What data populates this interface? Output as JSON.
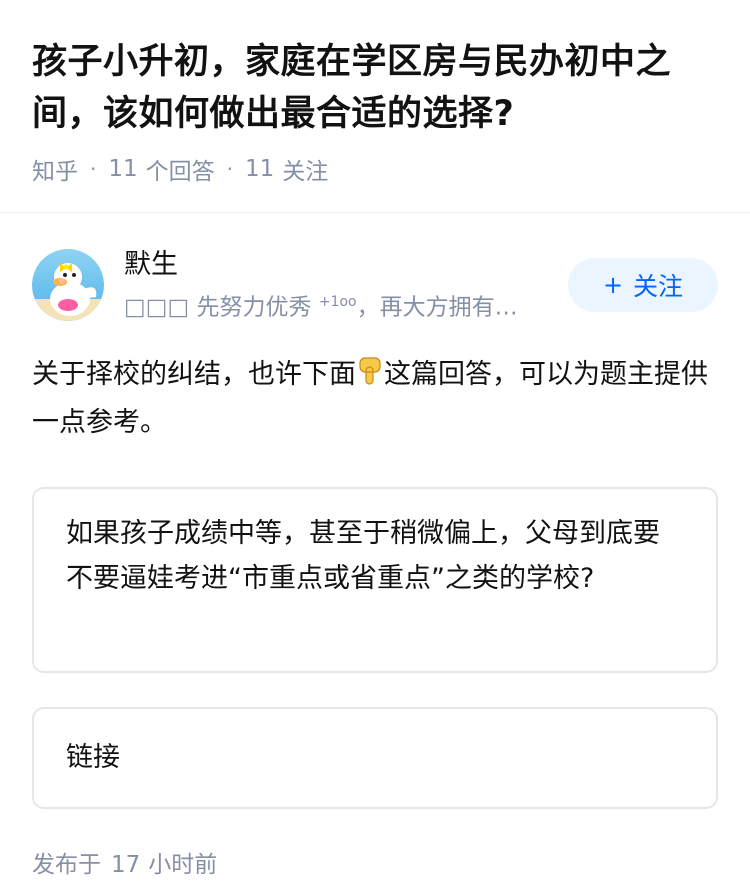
{
  "question": {
    "title": "孩子小升初，家庭在学区房与民办初中之间，该如何做出最合适的选择?",
    "source": "知乎",
    "answer_count": "11",
    "answer_label": "个回答",
    "follower_count": "11",
    "follower_label": "关注"
  },
  "author": {
    "name": "默生",
    "bio_prefix": "□□□ 先努力优秀",
    "bio_sup": "+1oo",
    "bio_suffix": "，再大方拥有…",
    "follow_label": "关注",
    "follow_icon": "plus-icon"
  },
  "answer": {
    "text_before": "关于择校的纠结，也许下面",
    "emoji": "pointing-down-hand-emoji",
    "text_after": "这篇回答，可以为题主提供一点参考。",
    "quote": "如果孩子成绩中等，甚至于稍微偏上，父母到底要不要逼娃考进“市重点或省重点”之类的学校?",
    "link_label": "链接"
  },
  "footer": {
    "prefix": "发布于",
    "number": "17",
    "unit": "小时前"
  },
  "colors": {
    "accent": "#0066ff",
    "follow_bg": "#ebf5ff",
    "meta_gray": "#8590a6",
    "border": "#e4e6eb"
  }
}
